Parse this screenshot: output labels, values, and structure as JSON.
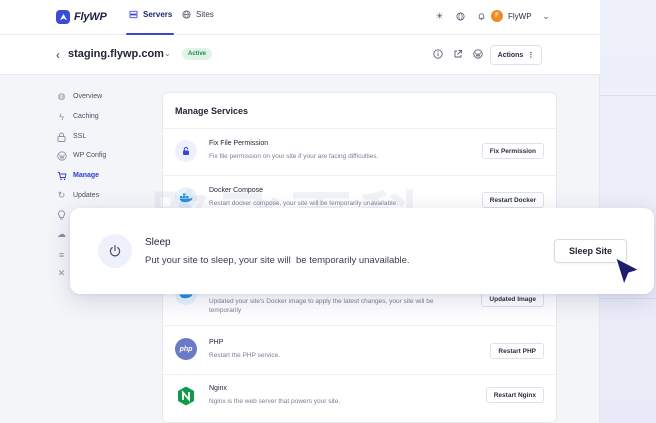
{
  "brand": {
    "name": "FlyWP",
    "accent": "#3646d6"
  },
  "nav": {
    "tabs": [
      {
        "label": "Servers",
        "icon": "server-icon",
        "active": true
      },
      {
        "label": "Sites",
        "icon": "globe-icon",
        "active": false
      }
    ],
    "utility_icons": [
      "sun-icon",
      "globe-icon",
      "bell-icon"
    ],
    "user": {
      "initial": "F",
      "name": "FlyWP"
    }
  },
  "server": {
    "name": "staging.flywp.com",
    "status": "Active",
    "actions_label": "Actions",
    "icons": [
      "info-icon",
      "external-link-icon",
      "wordpress-icon"
    ]
  },
  "sidebar": {
    "items": [
      {
        "label": "Overview",
        "icon": "globe-icon",
        "active": false
      },
      {
        "label": "Caching",
        "icon": "bolt-icon",
        "active": false
      },
      {
        "label": "SSL",
        "icon": "lock-icon",
        "active": false
      },
      {
        "label": "WP Config",
        "icon": "wordpress-icon",
        "active": false
      },
      {
        "label": "Manage",
        "icon": "cart-icon",
        "active": true
      },
      {
        "label": "Updates",
        "icon": "refresh-icon",
        "active": false
      },
      {
        "label": "",
        "icon": "bulb-icon",
        "active": false
      },
      {
        "label": "",
        "icon": "cloud-icon",
        "active": false
      },
      {
        "label": "",
        "icon": "list-icon",
        "active": false
      },
      {
        "label": "",
        "icon": "tools-icon",
        "active": false
      }
    ]
  },
  "panel": {
    "title": "Manage Services",
    "services": [
      {
        "name": "Fix File Permission",
        "desc": "Fix file permission on your site if your are facing difficulties.",
        "button": "Fix Permission",
        "icon": "lock-icon"
      },
      {
        "name": "Docker Compose",
        "desc": "Restart docker compose, your site will be temporarily unavailable.",
        "button": "Restart Docker",
        "icon": "docker-icon"
      },
      {
        "name": "",
        "desc": "Updated your site's Docker image to apply the latest changes, your site will be temporarily",
        "button": "Updated Image",
        "icon": "docker-icon"
      },
      {
        "name": "PHP",
        "desc": "Restart the PHP service.",
        "button": "Restart PHP",
        "icon": "php-icon"
      },
      {
        "name": "Nginx",
        "desc": "Nginx is the web server that powers your site.",
        "button": "Restart Nginx",
        "icon": "nginx-icon"
      }
    ]
  },
  "sleep": {
    "title": "Sleep",
    "desc": "Put your site to sleep, your site will  be temporarily unavailable.",
    "button": "Sleep Site",
    "icon": "power-icon"
  },
  "watermark": "路飞百科"
}
